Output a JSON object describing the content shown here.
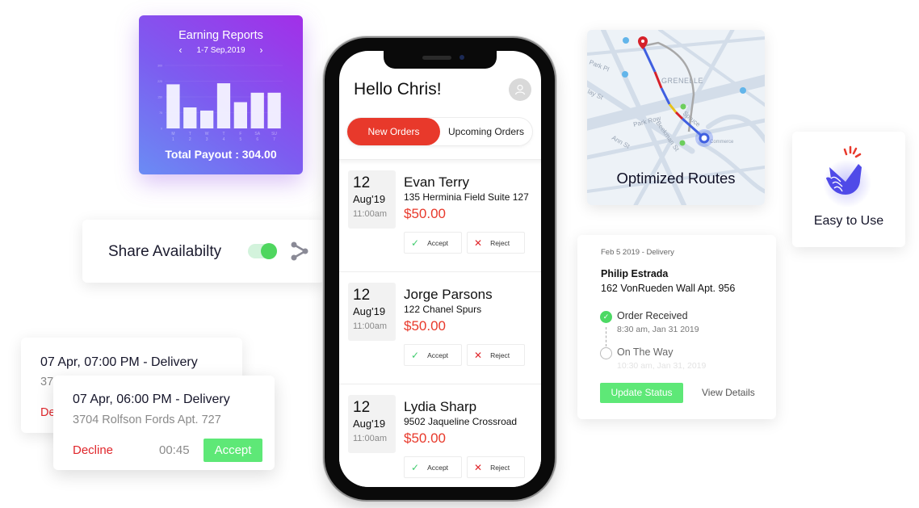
{
  "earning_report": {
    "title": "Earning Reports",
    "date_range": "1-7 Sep,2019",
    "prev_icon": "chevron-left-icon",
    "next_icon": "chevron-right-icon",
    "total_payout": "Total Payout : 304.00"
  },
  "chart_data": {
    "type": "bar",
    "title": "Earning Reports",
    "categories": [
      "M",
      "T",
      "W",
      "T",
      "F",
      "SA",
      "SU"
    ],
    "category_sublabels": [
      "1",
      "2",
      "3",
      "4",
      "5",
      "6",
      "7"
    ],
    "values": [
      210,
      100,
      85,
      215,
      125,
      170,
      170
    ],
    "yticks": [
      0,
      75,
      150,
      225,
      300
    ],
    "ylim": [
      0,
      300
    ],
    "xlabel": "",
    "ylabel": "",
    "grid": true
  },
  "share": {
    "label": "Share Availabilty",
    "toggle_on": true,
    "toggle_color": "#4fd65f",
    "share_icon": "share-icon"
  },
  "delivery_requests": [
    {
      "title": "07 Apr, 07:00 PM - Delivery",
      "address": "37",
      "decline": "De"
    },
    {
      "title": "07 Apr, 06:00 PM - Delivery",
      "address": "3704 Rolfson Fords Apt. 727",
      "decline": "Decline",
      "timer": "00:45",
      "accept": "Accept"
    }
  ],
  "phone": {
    "greeting": "Hello Chris!",
    "avatar_icon": "user-icon",
    "tabs": [
      {
        "label": "New Orders",
        "active": true
      },
      {
        "label": "Upcoming Orders",
        "active": false
      }
    ],
    "accent_color": "#e8392b",
    "orders": [
      {
        "day": "12",
        "month": "Aug'19",
        "time": "11:00am",
        "name": "Evan Terry",
        "address": "135 Herminia Field Suite 127",
        "price": "$50.00",
        "accept": "Accept",
        "reject": "Reject"
      },
      {
        "day": "12",
        "month": "Aug'19",
        "time": "11:00am",
        "name": "Jorge Parsons",
        "address": "122 Chanel Spurs",
        "price": "$50.00",
        "accept": "Accept",
        "reject": "Reject"
      },
      {
        "day": "12",
        "month": "Aug'19",
        "time": "11:00am",
        "name": "Lydia Sharp",
        "address": "9502 Jaqueline Crossroad",
        "price": "$50.00",
        "accept": "Accept",
        "reject": "Reject"
      }
    ]
  },
  "map_card": {
    "title": "Optimized Routes",
    "labels": [
      "GRENELLE",
      "Park Row",
      "Park Pl",
      "Ann St",
      "Beekman St",
      "Spruce",
      "Commerce",
      "lay St"
    ]
  },
  "easy_card": {
    "title": "Easy to Use",
    "icon": "snap-fingers-icon"
  },
  "status_card": {
    "header": "Feb 5 2019 - Delivery",
    "name": "Philip Estrada",
    "address": "162 VonRueden Wall Apt. 956",
    "steps": [
      {
        "label": "Order Received",
        "time": "8:30 am, Jan 31  2019",
        "done": true
      },
      {
        "label": "On The Way",
        "time": "10:30 am, Jan 31, 2019",
        "done": false
      }
    ],
    "update_button": "Update Status",
    "details_link": "View Details",
    "success_color": "#5ee877"
  }
}
